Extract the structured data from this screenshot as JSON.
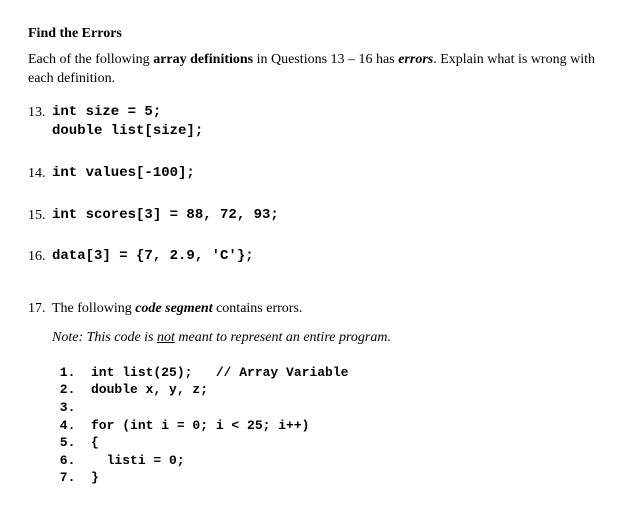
{
  "heading": "Find the Errors",
  "intro": {
    "t1": "Each of the following ",
    "t2": "array definitions",
    "t3": " in Questions 13 – 16 has ",
    "t4": "errors",
    "t5": ".  Explain what is wrong with each definition."
  },
  "q13": {
    "num": "13.",
    "line1": "int size = 5;",
    "line2": "double list[size];"
  },
  "q14": {
    "num": "14.",
    "line1": "int values[-100];"
  },
  "q15": {
    "num": "15.",
    "line1": "int scores[3] = 88, 72, 93;"
  },
  "q16": {
    "num": "16.",
    "line1": "data[3] = {7, 2.9, 'C'};"
  },
  "q17": {
    "num": "17.",
    "t1": "The following ",
    "t2": "code segment",
    "t3": " contains errors.",
    "note_t1": "Note: This code is ",
    "note_u": "not",
    "note_t2": " meant to represent an entire program.",
    "code": " 1.  int list(25);   // Array Variable\n 2.  double x, y, z;\n 3.\n 4.  for (int i = 0; i < 25; i++)\n 5.  {\n 6.    listi = 0;\n 7.  }"
  }
}
